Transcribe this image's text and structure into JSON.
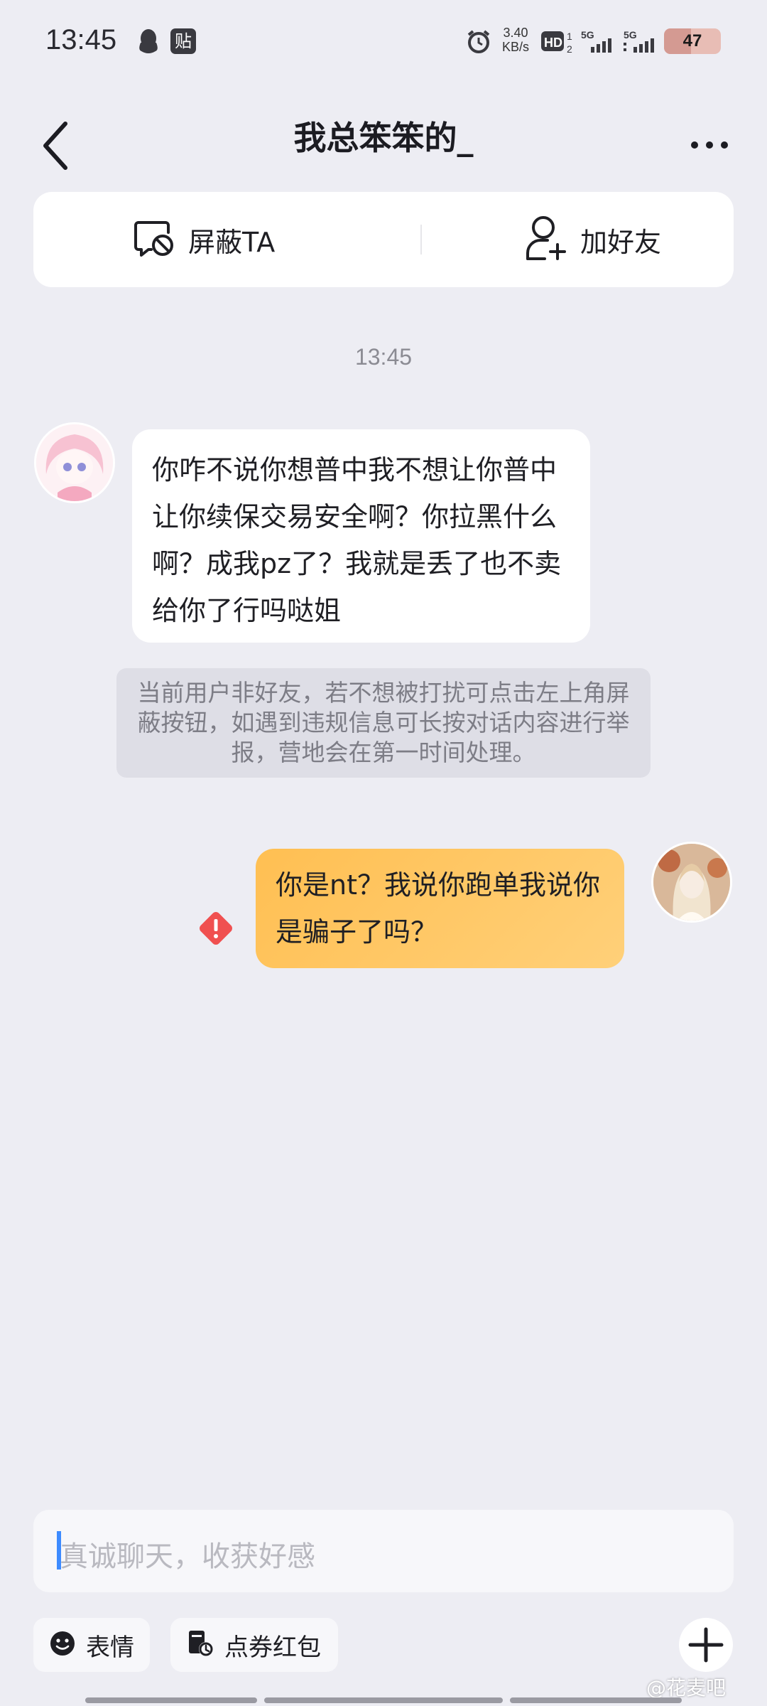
{
  "status_bar": {
    "time": "13:45",
    "tie_badge": "贴",
    "net_speed_value": "3.40",
    "net_speed_unit": "KB/s",
    "battery_level": "47",
    "icons": [
      "qq-icon",
      "tie-icon",
      "alarm-icon",
      "hd-icon",
      "signal-5g-icon",
      "signal-5g-icon",
      "battery-icon"
    ]
  },
  "header": {
    "title": "我总笨笨的_",
    "back_icon": "chevron-left-icon",
    "more_icon": "more-dots-icon"
  },
  "actions": {
    "block_label": "屏蔽TA",
    "add_friend_label": "加好友"
  },
  "chat": {
    "timestamp": "13:45",
    "incoming_message": "你咋不说你想普中我不想让你普中让你续保交易安全啊？你拉黑什么啊？成我pz了？我就是丢了也不卖给你了行吗哒姐",
    "notice": "当前用户非好友，若不想被打扰可点击左上角屏蔽按钮，如遇到违规信息可长按对话内容进行举报，营地会在第一时间处理。",
    "outgoing_message": "你是nt？我说你跑单我说你是骗子了吗？",
    "outgoing_status": "send-failed"
  },
  "input": {
    "placeholder": "真诚聊天，收获好感"
  },
  "toolbar": {
    "emoji_label": "表情",
    "coupon_label": "点券红包"
  },
  "watermark": "@花麦吧",
  "colors": {
    "background": "#ededf3",
    "outgoing_bubble": "#ffc35c",
    "incoming_bubble": "#ffffff",
    "error": "#f05050",
    "caret": "#3d8bff"
  }
}
